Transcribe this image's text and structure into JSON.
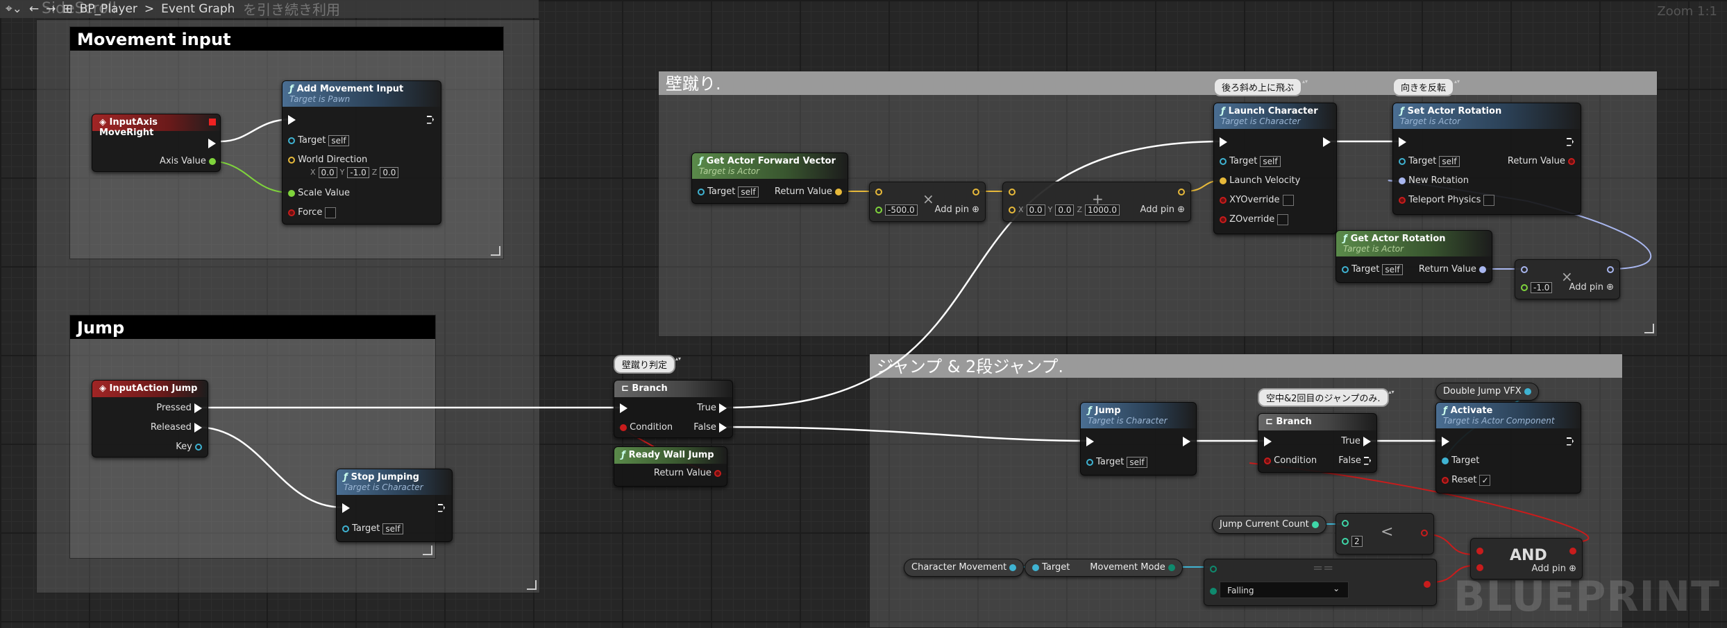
{
  "toolbar": {
    "breadcrumb_ghost": "SideScroll",
    "breadcrumb_ghost_2": "を引き続き利用",
    "blueprint": "BP_Player",
    "separator": ">",
    "graph": "Event Graph",
    "zoom": "Zoom 1:1"
  },
  "watermark": "BLUEPRINT",
  "comments": {
    "movement": "Movement input",
    "jump": "Jump",
    "walljump": "壁蹴り.",
    "doublejump": "ジャンプ & 2段ジャンプ."
  },
  "bubbles": {
    "launch": "後ろ斜め上に飛ぶ",
    "rotation": "向きを反転",
    "branch1": "壁蹴り判定",
    "branch2": "空中&2回目のジャンプのみ."
  },
  "nodes": {
    "moveright": {
      "title": "InputAxis MoveRight",
      "axis": "Axis Value"
    },
    "addmove": {
      "title": "Add Movement Input",
      "sub": "Target is Pawn",
      "target": "Target",
      "self": "self",
      "worlddir": "World Direction",
      "x": "0.0",
      "y": "-1.0",
      "z": "0.0",
      "scale": "Scale Value",
      "force": "Force"
    },
    "injump": {
      "title": "InputAction Jump",
      "pressed": "Pressed",
      "released": "Released",
      "key": "Key"
    },
    "stopjump": {
      "title": "Stop Jumping",
      "sub": "Target is Character",
      "target": "Target",
      "self": "self"
    },
    "fwd": {
      "title": "Get Actor Forward Vector",
      "sub": "Target is Actor",
      "target": "Target",
      "self": "self",
      "ret": "Return Value"
    },
    "mul1": {
      "val": "-500.0",
      "addpin": "Add pin"
    },
    "add1": {
      "x": "0.0",
      "y": "0.0",
      "z": "1000.0",
      "addpin": "Add pin"
    },
    "launch": {
      "title": "Launch Character",
      "sub": "Target is Character",
      "target": "Target",
      "self": "self",
      "velocity": "Launch Velocity",
      "xy": "XYOverride",
      "z": "ZOverride"
    },
    "setrot": {
      "title": "Set Actor Rotation",
      "sub": "Target is Actor",
      "target": "Target",
      "self": "self",
      "ret": "Return Value",
      "newrot": "New Rotation",
      "teleport": "Teleport Physics"
    },
    "getrot": {
      "title": "Get Actor Rotation",
      "sub": "Target is Actor",
      "target": "Target",
      "self": "self",
      "ret": "Return Value"
    },
    "mul2": {
      "val": "-1.0",
      "addpin": "Add pin"
    },
    "branch1": {
      "title": "Branch",
      "true": "True",
      "false": "False",
      "cond": "Condition"
    },
    "readywall": {
      "title": "Ready Wall Jump",
      "ret": "Return Value"
    },
    "jump": {
      "title": "Jump",
      "sub": "Target is Character",
      "target": "Target",
      "self": "self"
    },
    "branch2": {
      "title": "Branch",
      "true": "True",
      "false": "False",
      "cond": "Condition"
    },
    "dvfx": {
      "title": "Double Jump VFX"
    },
    "activate": {
      "title": "Activate",
      "sub": "Target is Actor Component",
      "target": "Target",
      "reset": "Reset",
      "check": "✓"
    },
    "jcount": {
      "title": "Jump Current Count"
    },
    "less": {
      "val": "2",
      "op": "<"
    },
    "and": {
      "title": "AND",
      "addpin": "Add pin"
    },
    "charmove": {
      "title": "Character Movement"
    },
    "movemode": {
      "target": "Target",
      "mode": "Movement Mode"
    },
    "equal": {
      "selected": "Falling",
      "op": "=="
    }
  }
}
